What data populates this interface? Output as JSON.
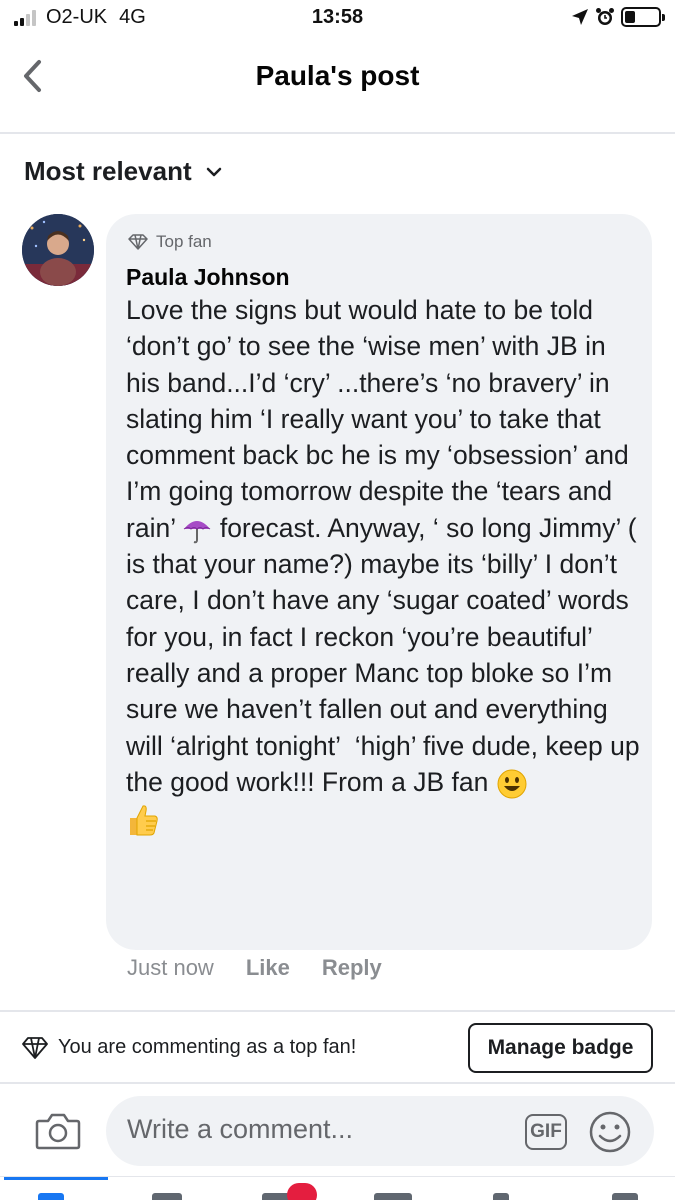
{
  "status_bar": {
    "carrier": "O2-UK",
    "network": "4G",
    "time": "13:58",
    "battery_level": 0.3
  },
  "header": {
    "title": "Paula's post",
    "back_icon": "chevron-left-icon"
  },
  "sort": {
    "label": "Most relevant",
    "icon": "chevron-down-icon"
  },
  "comment": {
    "badge": "Top fan",
    "author": "Paula Johnson",
    "text_part1": "Love the signs but would hate to be told ‘don’t go’ to see the ‘wise men’ with JB in his band...I’d ‘cry’ ...there’s ‘no bravery’ in slating him ‘I really want you’ to take that comment back bc he is my ‘obsession’ and I’m going tomorrow despite the ‘tears and rain’ ",
    "text_part2": " forecast. Anyway, ‘ so long Jimmy’ ( is that your name?) maybe its ‘billy’ I don’t care, I don’t have any ‘sugar coated’ words for you, in fact I reckon ‘you’re beautiful’ really and a proper Manc top bloke so I’m sure we haven’t fallen out and everything will ‘alright tonight’  ‘high’ five dude, keep up the good work!!! From a JB fan ",
    "emojis": [
      "umbrella-emoji",
      "smiley-emoji",
      "thumbs-up-emoji"
    ],
    "timestamp": "Just now",
    "like_label": "Like",
    "reply_label": "Reply"
  },
  "top_fan_bar": {
    "message": "You are commenting as a top fan!",
    "button_label": "Manage badge"
  },
  "composer": {
    "placeholder": "Write a comment...",
    "gif_label": "GIF"
  },
  "colors": {
    "accent": "#1877f2",
    "bubble": "#f0f2f5",
    "secondary_text": "#65676b",
    "notification": "#e41e3f"
  }
}
